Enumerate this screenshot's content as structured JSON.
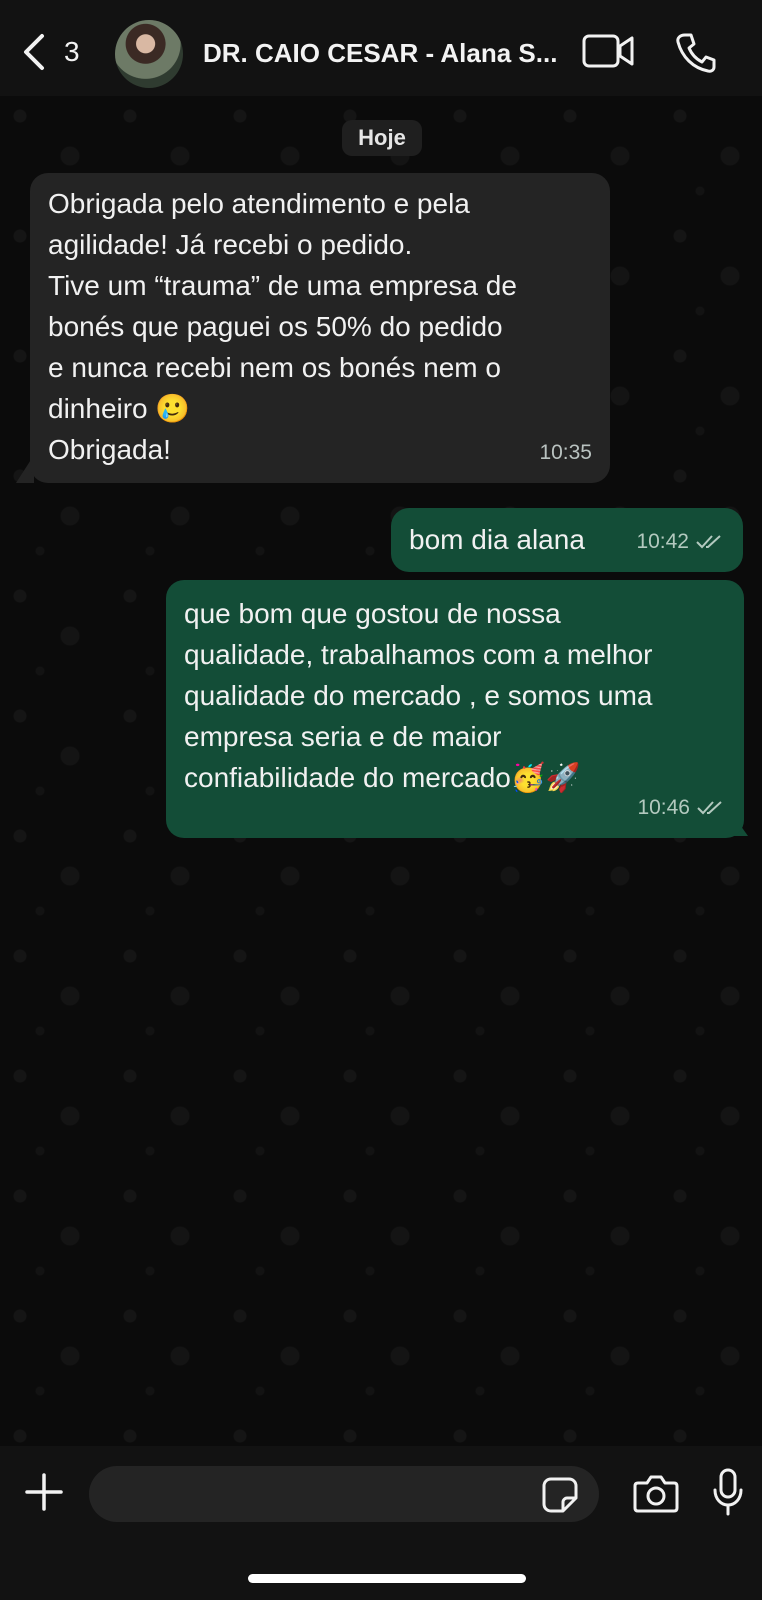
{
  "header": {
    "back_count": "3",
    "contact_name": "DR. CAIO CESAR - Alana S...",
    "icons": [
      "chevron-left-icon",
      "video-call-icon",
      "phone-icon"
    ]
  },
  "chat": {
    "date_chip": "Hoje",
    "messages": [
      {
        "direction": "incoming",
        "text": "Obrigada pelo atendimento e pela\nagilidade! Já recebi o pedido.\nTive um “trauma” de uma empresa de\nbonés que paguei os 50% do pedido\ne nunca recebi nem os bonés nem o\ndinheiro 🥲\nObrigada!",
        "time": "10:35"
      },
      {
        "direction": "outgoing",
        "text": "bom dia alana",
        "time": "10:42",
        "status": "read"
      },
      {
        "direction": "outgoing",
        "text": "que bom que gostou de nossa\nqualidade, trabalhamos com a melhor\nqualidade do mercado , e somos uma\nempresa seria e de maior\nconfiabilidade do mercado🥳🚀",
        "time": "10:46",
        "status": "read"
      }
    ]
  },
  "composer": {
    "value": "",
    "icons": [
      "plus-icon",
      "sticker-icon",
      "camera-icon",
      "microphone-icon"
    ]
  },
  "colors": {
    "incoming_bubble": "#242424",
    "outgoing_bubble": "#134d37",
    "background": "#0b0b0b"
  }
}
